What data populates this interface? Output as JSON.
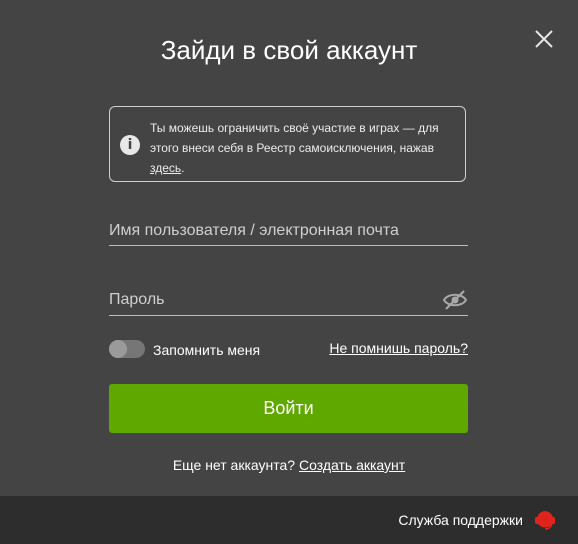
{
  "modal": {
    "title": "Зайди в свой аккаунт",
    "notice": {
      "text_before": "Ты можешь ограничить своё участие в играх — для этого внеси себя в Реестр самоисключения, нажав ",
      "link": "здесь",
      "text_after": "."
    },
    "username_placeholder": "Имя пользователя / электронная почта",
    "password_placeholder": "Пароль",
    "remember_label": "Запомнить меня",
    "forgot_link": "Не помнишь пароль?",
    "login_button": "Войти",
    "signup_text": "Еще нет аккаунта?",
    "signup_link": "Создать аккаунт"
  },
  "footer": {
    "support_label": "Служба поддержки"
  },
  "colors": {
    "background": "#444444",
    "footer": "#2d2d2d",
    "primary_button": "#5fa800",
    "support_icon": "#e0241b"
  },
  "icons": {
    "close": "close-icon",
    "info": "info-icon",
    "password_visibility": "eye-off-icon",
    "support": "headset-icon"
  }
}
